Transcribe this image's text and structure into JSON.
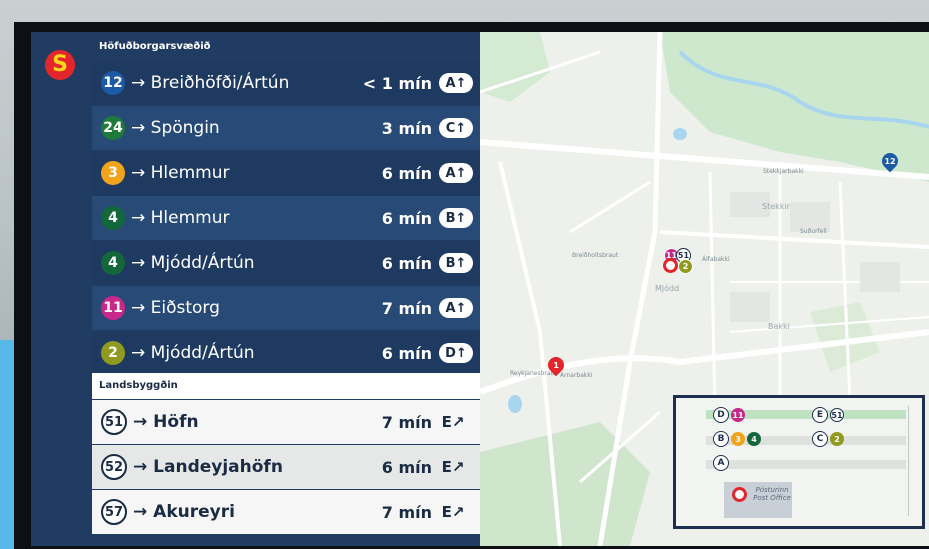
{
  "brand": {
    "logo_letter": "S",
    "logo_color": "#e3262b",
    "logo_text_color": "#f9d81c"
  },
  "sections": {
    "city": "Höfuðborgarsvæðið",
    "country": "Landsbyggðin"
  },
  "departures": [
    {
      "route": "12",
      "destination": "→ Breiðhöfði/Ártún",
      "time": "< 1 mín",
      "stop": "A↑",
      "color": "#1d5aa6"
    },
    {
      "route": "24",
      "destination": "→ Spöngin",
      "time": "3 mín",
      "stop": "C↑",
      "color": "#1f7a3a"
    },
    {
      "route": "3",
      "destination": "→ Hlemmur",
      "time": "6 mín",
      "stop": "A↑",
      "color": "#f0a31b"
    },
    {
      "route": "4",
      "destination": "→ Hlemmur",
      "time": "6 mín",
      "stop": "B↑",
      "color": "#14663b"
    },
    {
      "route": "4",
      "destination": "→ Mjódd/Ártún",
      "time": "6 mín",
      "stop": "B↑",
      "color": "#14663b"
    },
    {
      "route": "11",
      "destination": "→ Eiðstorg",
      "time": "7 mín",
      "stop": "A↑",
      "color": "#c8288a"
    },
    {
      "route": "2",
      "destination": "→ Mjódd/Ártún",
      "time": "6 mín",
      "stop": "D↑",
      "color": "#8f9a1f"
    }
  ],
  "regional": [
    {
      "route": "51",
      "destination": "→ Höfn",
      "time": "7 mín",
      "stop": "E↗"
    },
    {
      "route": "52",
      "destination": "→ Landeyjahöfn",
      "time": "6 mín",
      "stop": "E↗"
    },
    {
      "route": "57",
      "destination": "→ Akureyri",
      "time": "7 mín",
      "stop": "E↗"
    }
  ],
  "map": {
    "labels": [
      "Stekkir",
      "Mjódd",
      "Bakki",
      "Suðurfell",
      "Álfabakki",
      "Stekkjarbakki",
      "Reykjanesbraut",
      "Breiðholtsbraut",
      "Arnarbakki"
    ],
    "markers": {
      "cluster": [
        "11",
        "51",
        "2"
      ],
      "route_12": "12",
      "route_1": "1"
    },
    "inset": {
      "stops": [
        {
          "letter": "D",
          "routes": [
            "11"
          ]
        },
        {
          "letter": "E",
          "routes": [
            "51"
          ]
        },
        {
          "letter": "B",
          "routes": [
            "3",
            "4"
          ]
        },
        {
          "letter": "C",
          "routes": [
            "2"
          ]
        },
        {
          "letter": "A",
          "routes": []
        }
      ],
      "post_office": "Pósturinn\nPost Office"
    }
  }
}
